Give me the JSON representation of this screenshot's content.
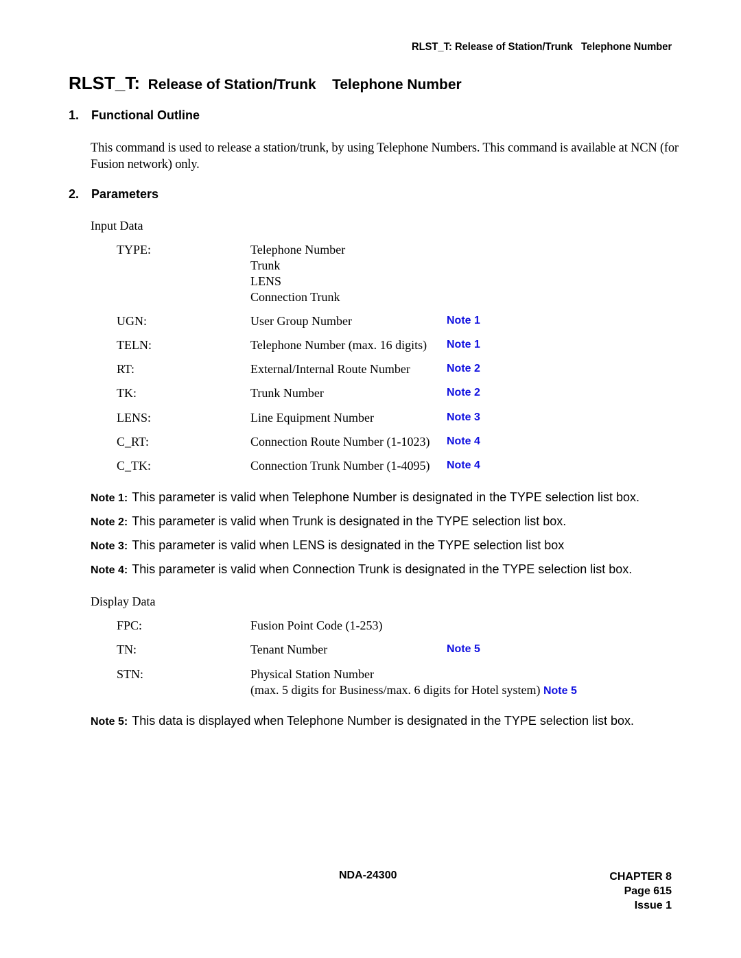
{
  "header": {
    "running_title": "RLST_T: Release of Station/Trunk   Telephone Number"
  },
  "title": {
    "command": "RLST_T:",
    "text": "Release of Station/Trunk    Telephone Number"
  },
  "sections": {
    "functional_outline": {
      "number": "1.",
      "heading": "Functional Outline",
      "body": "This command is used to release a station/trunk, by using Telephone Numbers. This command is available at NCN (for Fusion network) only."
    },
    "parameters": {
      "number": "2.",
      "heading": "Parameters"
    }
  },
  "input_data": {
    "heading": "Input Data",
    "type_param": {
      "name": "TYPE:",
      "options": [
        "Telephone Number",
        "Trunk",
        "LENS",
        "Connection Trunk"
      ]
    },
    "params": [
      {
        "name": "UGN:",
        "desc": "User Group Number",
        "note": "Note 1"
      },
      {
        "name": "TELN:",
        "desc": "Telephone Number (max. 16 digits)",
        "note": "Note 1"
      },
      {
        "name": "RT:",
        "desc": "External/Internal Route Number",
        "note": "Note 2"
      },
      {
        "name": "TK:",
        "desc": "Trunk Number",
        "note": "Note 2"
      },
      {
        "name": "LENS:",
        "desc": "Line Equipment Number",
        "note": "Note 3"
      },
      {
        "name": "C_RT:",
        "desc": "Connection Route Number (1-1023)",
        "note": "Note 4"
      },
      {
        "name": "C_TK:",
        "desc": "Connection Trunk Number (1-4095)",
        "note": "Note 4"
      }
    ]
  },
  "notes": [
    {
      "label": "Note 1:",
      "text": "This parameter is valid when Telephone Number is designated in the TYPE  selection list box."
    },
    {
      "label": "Note 2:",
      "text": "This parameter is valid when Trunk  is designated in the TYPE  selection list box."
    },
    {
      "label": "Note 3:",
      "text": "This parameter is valid when LENS  is designated in the TYPE  selection list box"
    },
    {
      "label": "Note 4:",
      "text": "This parameter is valid when Connection Trunk is designated in the TYPE  selection list box."
    }
  ],
  "display_data": {
    "heading": "Display Data",
    "params": [
      {
        "name": "FPC:",
        "desc": "Fusion Point Code (1-253)",
        "note": ""
      },
      {
        "name": "TN:",
        "desc": "Tenant Number",
        "note": "Note 5"
      },
      {
        "name": "STN:",
        "desc": "Physical Station Number",
        "desc2": "(max. 5 digits for Business/max. 6 digits for Hotel system)",
        "note": "Note 5"
      }
    ]
  },
  "note5": {
    "label": "Note 5:",
    "text": "This data is displayed when Telephone Number is designated in the TYPE  selection list box."
  },
  "footer": {
    "doc_number": "NDA-24300",
    "chapter": "CHAPTER 8",
    "page": "Page 615",
    "issue": "Issue 1"
  },
  "colors": {
    "note_reference": "#1010e0",
    "text": "#000000"
  }
}
